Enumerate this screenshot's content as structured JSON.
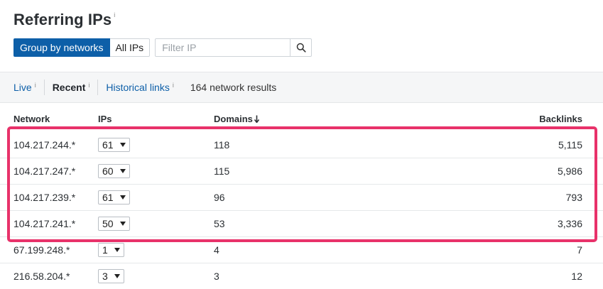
{
  "header": {
    "title": "Referring IPs",
    "info": "i"
  },
  "controls": {
    "group_by_networks": "Group by networks",
    "all_ips": "All IPs",
    "filter_placeholder": "Filter IP"
  },
  "tabs": {
    "live": "Live",
    "recent": "Recent",
    "historical": "Historical links",
    "info": "i",
    "results": "164 network results"
  },
  "table": {
    "columns": {
      "network": "Network",
      "ips": "IPs",
      "domains": "Domains",
      "backlinks": "Backlinks"
    },
    "rows": [
      {
        "network": "104.217.244.*",
        "ips": "61",
        "domains": "118",
        "backlinks": "5,115"
      },
      {
        "network": "104.217.247.*",
        "ips": "60",
        "domains": "115",
        "backlinks": "5,986"
      },
      {
        "network": "104.217.239.*",
        "ips": "61",
        "domains": "96",
        "backlinks": "793"
      },
      {
        "network": "104.217.241.*",
        "ips": "50",
        "domains": "53",
        "backlinks": "3,336"
      },
      {
        "network": "67.199.248.*",
        "ips": "1",
        "domains": "4",
        "backlinks": "7"
      },
      {
        "network": "216.58.204.*",
        "ips": "3",
        "domains": "3",
        "backlinks": "12"
      }
    ]
  },
  "colors": {
    "accent": "#0d5fa8",
    "highlight": "#e8326a"
  }
}
